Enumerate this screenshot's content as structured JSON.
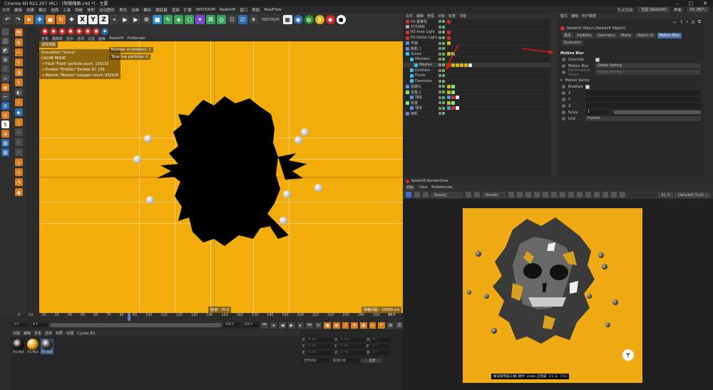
{
  "title": "Cinema 4D R21.207 (RC) - [制做幢面.c4d *] - 主要",
  "menubar": {
    "items": [
      "文件",
      "编辑",
      "创建",
      "模式",
      "选择",
      "工具",
      "网格",
      "体积",
      "运动图形",
      "角色",
      "动画",
      "模拟",
      "跟踪器",
      "渲染",
      "扩展",
      "INSYDIUM",
      "Redshift",
      "窗口",
      "帮助",
      "RealFlow"
    ],
    "layout_label": "节点空间:",
    "layout_value": "当前 (Redshift)",
    "interface_label": "界面:",
    "interface_value": "RS (用户)"
  },
  "toolbar": {
    "xyz": [
      "X",
      "Y",
      "Z"
    ],
    "plugin_label": "INSYDIUM"
  },
  "toolbar2": {
    "redshift": "Redshift",
    "prorender": "ProRender"
  },
  "viewport": {
    "menu": [
      "查看",
      "摄像机",
      "显示",
      "选项",
      "过滤",
      "面板",
      "Redshift",
      "ProRender"
    ],
    "camera_label": "透视视图",
    "info_lines": [
      "Simulation \"Scene\"",
      "CACHE MODE",
      "→ Fluid \"Fluid\" particle count: 135133",
      "→ Emitter \"Emitter\" Emitter ID: 100",
      "→ Mesher \"Mesher\" polygon count: 932524"
    ],
    "emitters_line": "Number of emitters: 1",
    "particles_line": "Total live particles: 0",
    "speed_label": "帧速：70.0",
    "grid_label": "网格间距：10000 cm"
  },
  "timeline": {
    "ticks": [
      "0",
      "10",
      "20",
      "30",
      "40",
      "50",
      "60",
      "70",
      "80",
      "90",
      "100",
      "110",
      "120",
      "130",
      "140",
      "150",
      "160",
      "170",
      "180",
      "190",
      "200",
      "210",
      "220",
      "230",
      "240",
      "250"
    ],
    "current": "80 F",
    "start": "0 F",
    "start2": "0 F",
    "end": "250 F",
    "end2": "250 F"
  },
  "materials": {
    "menu": [
      "创建",
      "编辑",
      "查看",
      "选择",
      "材质",
      "纹理",
      "Cycles 4D"
    ],
    "items": [
      {
        "label": "RS Mat",
        "color": "#1a1a1a"
      },
      {
        "label": "RS Mat",
        "color": "#e8a412"
      },
      {
        "label": "RS Mat",
        "color": "#3a3a3a"
      }
    ]
  },
  "coords": {
    "rows": [
      {
        "a": "X",
        "av": "0 cm",
        "b": "X",
        "bv": "0 cm",
        "c": "H",
        "cv": "0 °"
      },
      {
        "a": "Y",
        "av": "0 cm",
        "b": "Y",
        "bv": "0 cm",
        "c": "P",
        "cv": "0 °"
      },
      {
        "a": "Z",
        "av": "0 cm",
        "b": "Z",
        "bv": "0 cm",
        "c": "B",
        "cv": "0 °"
      }
    ],
    "mode1": "世界坐标",
    "mode2": "缩放比例",
    "apply": "应用"
  },
  "objects": {
    "menu": [
      "文件",
      "编辑",
      "查看",
      "对象",
      "标签",
      "书签"
    ],
    "rows": [
      {
        "name": "RS 摄像机",
        "indent": 0,
        "icon": "#c33"
      },
      {
        "name": "灯光目标",
        "indent": 0,
        "icon": "#aaa"
      },
      {
        "name": "RS Area Light",
        "indent": 0,
        "icon": "#c33"
      },
      {
        "name": "RS Dome Light",
        "indent": 0,
        "icon": "#c33"
      },
      {
        "name": "平面",
        "indent": 0,
        "icon": "#4a9ae0"
      },
      {
        "name": "随机 1",
        "indent": 0,
        "icon": "#7a7af0"
      },
      {
        "name": "Scene",
        "indent": 0,
        "icon": "#3ec0e0"
      },
      {
        "name": "Meshers",
        "indent": 1,
        "icon": "#3ec0e0"
      },
      {
        "name": "Mesher",
        "indent": 2,
        "icon": "#3ec0e0"
      },
      {
        "name": "Emitters",
        "indent": 1,
        "icon": "#3ec0e0"
      },
      {
        "name": "Fluids",
        "indent": 1,
        "icon": "#3ec0e0"
      },
      {
        "name": "Daemons",
        "indent": 1,
        "icon": "#3ec0e0"
      },
      {
        "name": "骷髅头",
        "indent": 0,
        "icon": "#4a9ae0"
      },
      {
        "name": "克隆.1",
        "indent": 0,
        "icon": "#7af07a"
      },
      {
        "name": "球体",
        "indent": 1,
        "icon": "#4a9ae0"
      },
      {
        "name": "克隆",
        "indent": 0,
        "icon": "#7af07a"
      },
      {
        "name": "球体",
        "indent": 1,
        "icon": "#4a9ae0"
      },
      {
        "name": "随机",
        "indent": 0,
        "icon": "#7a7af0"
      }
    ]
  },
  "attributes": {
    "menu": [
      "模式",
      "编辑",
      "用户数据"
    ],
    "object_title": "Redshift Object [Redshift Object]",
    "tabs": [
      "基本",
      "Visibility",
      "Geometry",
      "Matte",
      "Object ID",
      "Motion Blur"
    ],
    "tab_exclusion": "Exclusion",
    "section": "Motion Blur",
    "override_label": "Override",
    "motion_blur_label": "Motion Blur",
    "motion_blur_value": "Global Setting",
    "deform_label": "Deformation Steps",
    "deform_value": "Global Setting",
    "mv_section": "Motion Vector",
    "enabled_label": "Enabled",
    "x_label": "X",
    "y_label": "Y",
    "z_label": "Z",
    "scale_label": "Scale",
    "scale_value": "1",
    "unit_label": "Unit",
    "unit_value": "Frames"
  },
  "renderview": {
    "title": "Redshift RenderView",
    "menu": [
      "File",
      "View",
      "Preferences"
    ],
    "beauty": "Beauty",
    "render_label": "Render",
    "zoom": "91 %",
    "fit": "Detailed (Cust..)",
    "status": "帧渲染完成(1帧) 耗时: 2m8s  已完成: 1/1  (2. 77s)"
  },
  "colors": {
    "accent": "#4d6c9e",
    "viewport_bg": "#f2ad0b",
    "arrow": "#e01818"
  }
}
